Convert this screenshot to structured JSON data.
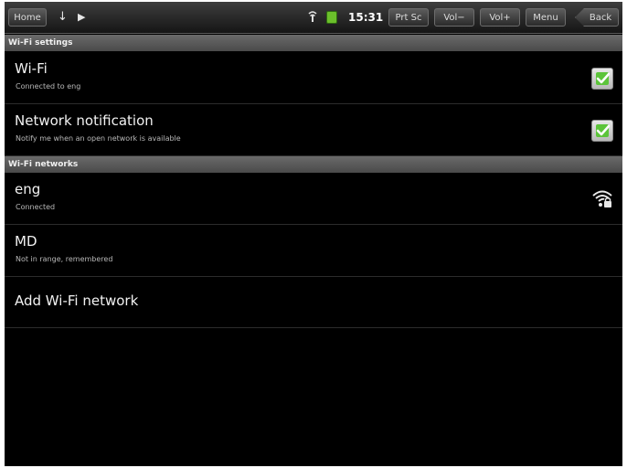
{
  "status_bar": {
    "home_label": "Home",
    "clock": "15:31",
    "prtsc_label": "Prt Sc",
    "vol_down_label": "Vol−",
    "vol_up_label": "Vol+",
    "menu_label": "Menu",
    "back_label": "Back",
    "icons": [
      "usb-icon",
      "play-icon",
      "signal-icon",
      "battery-icon"
    ]
  },
  "sections": {
    "wifi_settings_header": "Wi-Fi settings",
    "wifi_networks_header": "Wi-Fi networks"
  },
  "wifi": {
    "title": "Wi-Fi",
    "subtitle": "Connected to eng",
    "checked": true
  },
  "notification": {
    "title": "Network notification",
    "subtitle": "Notify me when an open network is available",
    "checked": true
  },
  "networks": [
    {
      "name": "eng",
      "status": "Connected",
      "icon": "wifi-lock-icon"
    },
    {
      "name": "MD",
      "status": "Not in range, remembered"
    }
  ],
  "add_network_label": "Add Wi-Fi network",
  "colors": {
    "checkbox_check": "#5cc43a",
    "header_bg": "#5a5a5a",
    "background": "#000000"
  }
}
